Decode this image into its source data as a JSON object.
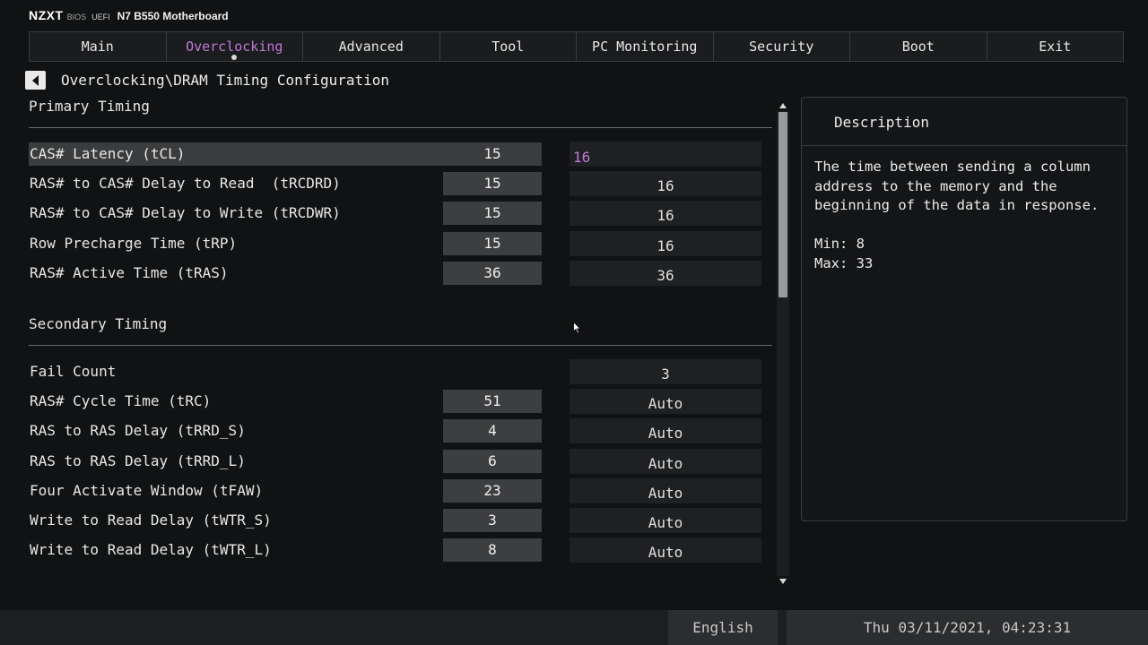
{
  "header": {
    "logo": "NZXT",
    "bios": "BIOS",
    "uefi": "UEFI",
    "model": "N7 B550 Motherboard"
  },
  "tabs": [
    {
      "label": "Main",
      "active": false
    },
    {
      "label": "Overclocking",
      "active": true
    },
    {
      "label": "Advanced",
      "active": false
    },
    {
      "label": "Tool",
      "active": false
    },
    {
      "label": "PC Monitoring",
      "active": false
    },
    {
      "label": "Security",
      "active": false
    },
    {
      "label": "Boot",
      "active": false
    },
    {
      "label": "Exit",
      "active": false
    }
  ],
  "breadcrumb": "Overclocking\\DRAM Timing Configuration",
  "primary": {
    "title": "Primary Timing",
    "rows": [
      {
        "label": "CAS# Latency (tCL)",
        "current": "15",
        "value": "16"
      },
      {
        "label": "RAS# to CAS# Delay to Read  (tRCDRD)",
        "current": "15",
        "value": "16"
      },
      {
        "label": "RAS# to CAS# Delay to Write (tRCDWR)",
        "current": "15",
        "value": "16"
      },
      {
        "label": "Row Precharge Time (tRP)",
        "current": "15",
        "value": "16"
      },
      {
        "label": "RAS# Active Time (tRAS)",
        "current": "36",
        "value": "36"
      }
    ]
  },
  "secondary": {
    "title": "Secondary Timing",
    "rows": [
      {
        "label": "Fail Count",
        "current": "",
        "value": "3"
      },
      {
        "label": "RAS# Cycle Time (tRC)",
        "current": "51",
        "value": "Auto"
      },
      {
        "label": "RAS to RAS Delay (tRRD_S)",
        "current": "4",
        "value": "Auto"
      },
      {
        "label": "RAS to RAS Delay (tRRD_L)",
        "current": "6",
        "value": "Auto"
      },
      {
        "label": "Four Activate Window (tFAW)",
        "current": "23",
        "value": "Auto"
      },
      {
        "label": "Write to Read Delay (tWTR_S)",
        "current": "3",
        "value": "Auto"
      },
      {
        "label": "Write to Read Delay (tWTR_L)",
        "current": "8",
        "value": "Auto"
      }
    ]
  },
  "description": {
    "title": "Description",
    "text": "The time between sending a column\naddress to the memory and the\nbeginning of the data in response.\n\nMin: 8\nMax: 33"
  },
  "footer": {
    "language": "English",
    "datetime": "Thu 03/11/2021, 04:23:31"
  },
  "colors": {
    "accent": "#c178d8",
    "background": "#111213"
  }
}
